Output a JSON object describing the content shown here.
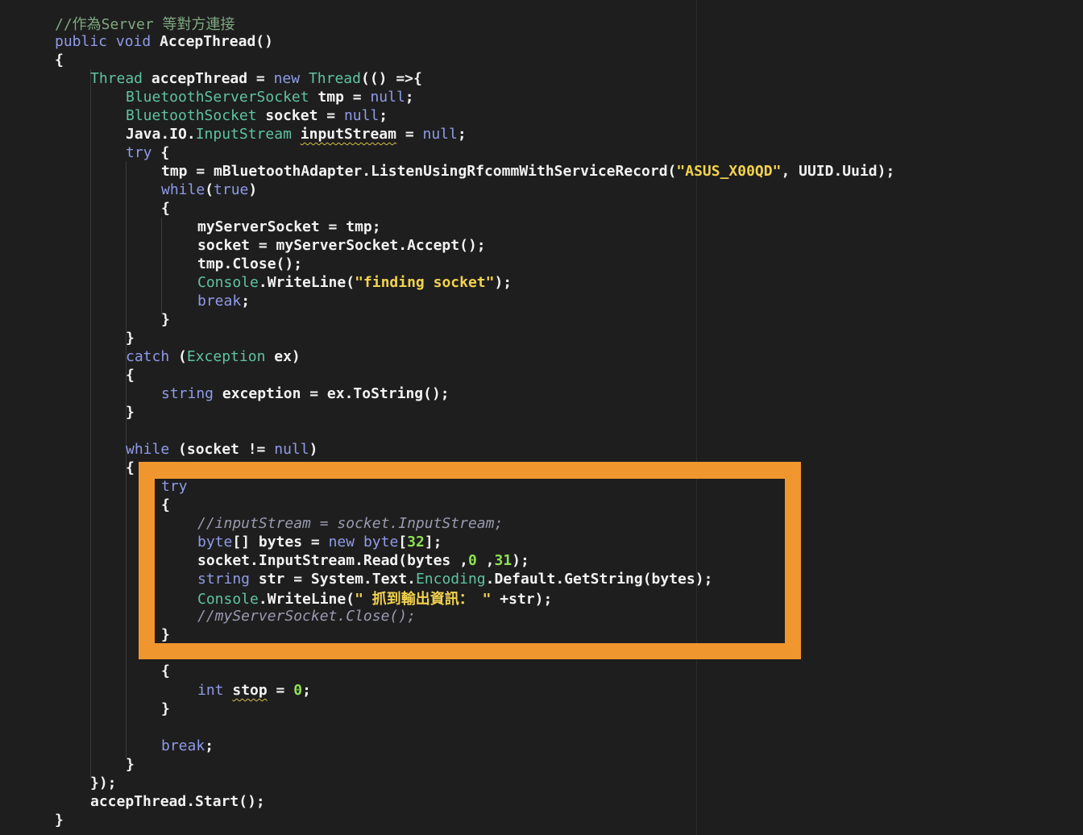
{
  "colors": {
    "background": "#1e1e1e",
    "keyword": "#8f9be8",
    "type": "#5fc3a0",
    "string": "#f2d24e",
    "number": "#8ee052",
    "comment": "#9a9ab0",
    "highlight_box": "#f0962f"
  },
  "code": {
    "lines": [
      {
        "tokens": [
          {
            "t": "//作為Server 等對方連接",
            "c": "comment2"
          }
        ]
      },
      {
        "tokens": [
          {
            "t": "public",
            "c": "keyword"
          },
          {
            "t": " "
          },
          {
            "t": "void",
            "c": "keyword"
          },
          {
            "t": " AccepThread()"
          }
        ]
      },
      {
        "tokens": [
          {
            "t": "{"
          }
        ]
      },
      {
        "tokens": [
          {
            "t": "Thread",
            "c": "type"
          },
          {
            "t": " accepThread = "
          },
          {
            "t": "new",
            "c": "keyword"
          },
          {
            "t": " "
          },
          {
            "t": "Thread",
            "c": "type"
          },
          {
            "t": "(() =>{"
          }
        ]
      },
      {
        "tokens": [
          {
            "t": "BluetoothServerSocket",
            "c": "type"
          },
          {
            "t": " tmp = "
          },
          {
            "t": "null",
            "c": "keyword"
          },
          {
            "t": ";"
          }
        ]
      },
      {
        "tokens": [
          {
            "t": "BluetoothSocket",
            "c": "type"
          },
          {
            "t": " socket = "
          },
          {
            "t": "null",
            "c": "keyword"
          },
          {
            "t": ";"
          }
        ]
      },
      {
        "tokens": [
          {
            "t": "Java.IO."
          },
          {
            "t": "InputStream",
            "c": "type"
          },
          {
            "t": " "
          },
          {
            "t": "inputStream",
            "c": "squiggle"
          },
          {
            "t": " = "
          },
          {
            "t": "null",
            "c": "keyword"
          },
          {
            "t": ";"
          }
        ]
      },
      {
        "tokens": [
          {
            "t": "try",
            "c": "keyword"
          },
          {
            "t": " {"
          }
        ]
      },
      {
        "tokens": [
          {
            "t": "tmp = mBluetoothAdapter.ListenUsingRfcommWithServiceRecord("
          },
          {
            "t": "\"ASUS_X00QD\"",
            "c": "string"
          },
          {
            "t": ", UUID.Uuid);"
          }
        ]
      },
      {
        "tokens": [
          {
            "t": "while",
            "c": "keyword"
          },
          {
            "t": "("
          },
          {
            "t": "true",
            "c": "keyword"
          },
          {
            "t": ")"
          }
        ]
      },
      {
        "tokens": [
          {
            "t": "{"
          }
        ]
      },
      {
        "tokens": [
          {
            "t": "myServerSocket = tmp;"
          }
        ]
      },
      {
        "tokens": [
          {
            "t": "socket = myServerSocket.Accept();"
          }
        ]
      },
      {
        "tokens": [
          {
            "t": "tmp.Close();"
          }
        ]
      },
      {
        "tokens": [
          {
            "t": "Console",
            "c": "type"
          },
          {
            "t": ".WriteLine("
          },
          {
            "t": "\"finding socket\"",
            "c": "string"
          },
          {
            "t": ");"
          }
        ]
      },
      {
        "tokens": [
          {
            "t": "break",
            "c": "keyword"
          },
          {
            "t": ";"
          }
        ]
      },
      {
        "tokens": [
          {
            "t": "}"
          }
        ]
      },
      {
        "tokens": [
          {
            "t": "}"
          }
        ]
      },
      {
        "tokens": [
          {
            "t": "catch",
            "c": "keyword"
          },
          {
            "t": " ("
          },
          {
            "t": "Exception",
            "c": "type"
          },
          {
            "t": " ex)"
          }
        ]
      },
      {
        "tokens": [
          {
            "t": "{"
          }
        ]
      },
      {
        "tokens": [
          {
            "t": "string",
            "c": "keyword"
          },
          {
            "t": " exception = ex.ToString();"
          }
        ]
      },
      {
        "tokens": [
          {
            "t": "}"
          }
        ]
      },
      {
        "tokens": [
          {
            "t": "while",
            "c": "keyword"
          },
          {
            "t": " (socket != "
          },
          {
            "t": "null",
            "c": "keyword"
          },
          {
            "t": ")"
          }
        ]
      },
      {
        "tokens": [
          {
            "t": "{"
          }
        ]
      },
      {
        "tokens": [
          {
            "t": "try",
            "c": "keyword"
          }
        ]
      },
      {
        "tokens": [
          {
            "t": "{"
          }
        ]
      },
      {
        "tokens": [
          {
            "t": "//inputStream = socket.InputStream;",
            "c": "comment"
          }
        ]
      },
      {
        "tokens": [
          {
            "t": "byte",
            "c": "keyword"
          },
          {
            "t": "[] bytes = "
          },
          {
            "t": "new",
            "c": "keyword"
          },
          {
            "t": " "
          },
          {
            "t": "byte",
            "c": "keyword"
          },
          {
            "t": "["
          },
          {
            "t": "32",
            "c": "number"
          },
          {
            "t": "];"
          }
        ]
      },
      {
        "tokens": [
          {
            "t": "socket.InputStream.Read(bytes ,"
          },
          {
            "t": "0",
            "c": "number"
          },
          {
            "t": " ,"
          },
          {
            "t": "31",
            "c": "number"
          },
          {
            "t": ");"
          }
        ]
      },
      {
        "tokens": [
          {
            "t": "string",
            "c": "keyword"
          },
          {
            "t": " str = System.Text."
          },
          {
            "t": "Encoding",
            "c": "type"
          },
          {
            "t": ".Default.GetString(bytes);"
          }
        ]
      },
      {
        "tokens": [
          {
            "t": "Console",
            "c": "type"
          },
          {
            "t": ".WriteLine("
          },
          {
            "t": "\" 抓到輸出資訊： \"",
            "c": "string"
          },
          {
            "t": " +str);"
          }
        ]
      },
      {
        "tokens": [
          {
            "t": "//myServerSocket.Close();",
            "c": "comment"
          }
        ]
      },
      {
        "tokens": [
          {
            "t": "}"
          }
        ]
      },
      {
        "tokens": [
          {
            "t": "{"
          }
        ]
      },
      {
        "tokens": [
          {
            "t": "int",
            "c": "keyword"
          },
          {
            "t": " "
          },
          {
            "t": "stop",
            "c": "squiggle"
          },
          {
            "t": " = "
          },
          {
            "t": "0",
            "c": "number"
          },
          {
            "t": ";"
          }
        ]
      },
      {
        "tokens": [
          {
            "t": "}"
          }
        ]
      },
      {
        "tokens": [
          {
            "t": "break",
            "c": "keyword"
          },
          {
            "t": ";"
          }
        ]
      },
      {
        "tokens": [
          {
            "t": "}"
          }
        ]
      },
      {
        "tokens": [
          {
            "t": "});"
          }
        ]
      },
      {
        "tokens": [
          {
            "t": "accepThread.Start();"
          }
        ]
      },
      {
        "tokens": [
          {
            "t": "}"
          }
        ]
      }
    ]
  }
}
